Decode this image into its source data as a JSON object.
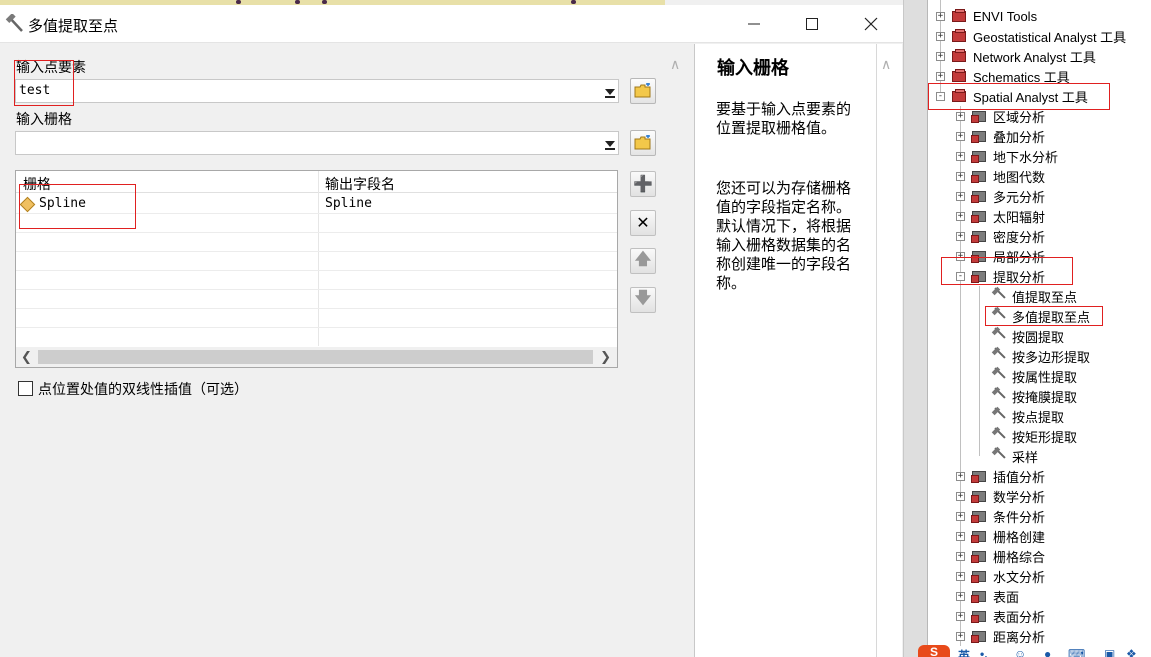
{
  "dialog": {
    "title": "多值提取至点",
    "input_points_label": "输入点要素",
    "input_points_value": "test",
    "input_raster_label": "输入栅格",
    "input_raster_value": "",
    "grid": {
      "col1_header": "栅格",
      "col2_header": "输出字段名",
      "rows": [
        {
          "raster": "Spline",
          "field": "Spline"
        }
      ]
    },
    "checkbox_label": "点位置处值的双线性插值（可选）",
    "checkbox_checked": false
  },
  "help": {
    "title": "输入栅格",
    "para1": "要基于输入点要素的位置提取栅格值。",
    "para2": "您还可以为存储栅格值的字段指定名称。默认情况下，将根据输入栅格数据集的名称创建唯一的字段名称。"
  },
  "tree": {
    "toolboxes": [
      {
        "label": "ENVI Tools",
        "state": "+"
      },
      {
        "label": "Geostatistical Analyst 工具",
        "state": "+"
      },
      {
        "label": "Network Analyst 工具",
        "state": "+"
      },
      {
        "label": "Schematics 工具",
        "state": "+"
      },
      {
        "label": "Spatial Analyst 工具",
        "state": "-"
      }
    ],
    "spatial_toolsets_before": [
      "区域分析",
      "叠加分析",
      "地下水分析",
      "地图代数",
      "多元分析",
      "太阳辐射",
      "密度分析",
      "局部分析"
    ],
    "extraction_toolset": "提取分析",
    "extraction_tools": [
      "值提取至点",
      "多值提取至点",
      "按圆提取",
      "按多边形提取",
      "按属性提取",
      "按掩膜提取",
      "按点提取",
      "按矩形提取",
      "采样"
    ],
    "spatial_toolsets_after": [
      "插值分析",
      "数学分析",
      "条件分析",
      "栅格创建",
      "栅格综合",
      "水文分析",
      "表面",
      "表面分析",
      "距离分析"
    ]
  },
  "taskbar": {
    "ime_label": "英"
  },
  "colors": {
    "highlight_box": "#e02020",
    "toolbox_red": "#c23a3a"
  }
}
